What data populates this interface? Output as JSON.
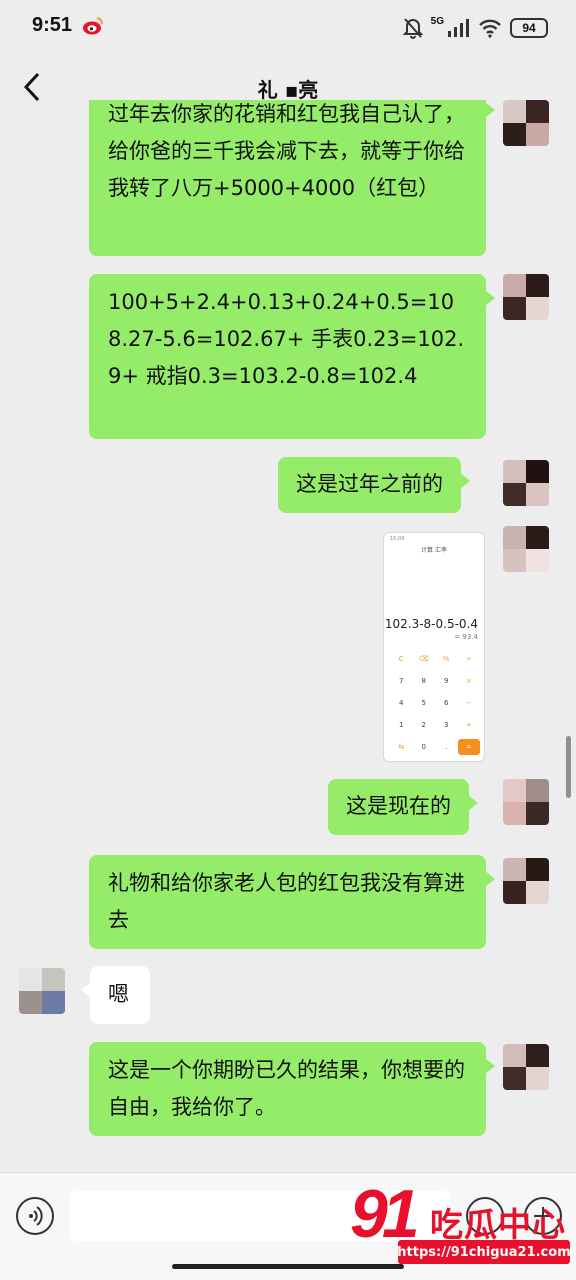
{
  "status_bar": {
    "time": "9:51",
    "network": "5G",
    "battery": "94",
    "icons": [
      "weibo-icon",
      "mute-bell-icon",
      "signal-icon",
      "wifi-icon",
      "battery-icon"
    ]
  },
  "header": {
    "title": "礼 ▪亮",
    "back_icon": "chevron-left-icon"
  },
  "messages": [
    {
      "side": "me",
      "text": "过年去你家的花销和红包我自己认了，给你爸的三千我会减下去，就等于你给我转了八万+5000+4000（红包）"
    },
    {
      "side": "me",
      "text": "100+5+2.4+0.13+0.24+0.5=108.27-5.6=102.67+ 手表0.23=102.9+ 戒指0.3=103.2-0.8=102.4"
    },
    {
      "side": "me",
      "text": "这是过年之前的"
    },
    {
      "side": "me",
      "type": "image",
      "image": {
        "status_time": "10:09",
        "tabs": "计算   汇率",
        "expression": "102.3-8-0.5-0.4",
        "result": "= 93.4",
        "keys": [
          "C",
          "⌫",
          "%",
          "÷",
          "7",
          "8",
          "9",
          "×",
          "4",
          "5",
          "6",
          "−",
          "1",
          "2",
          "3",
          "+",
          "⇆",
          "0",
          ".",
          "="
        ]
      }
    },
    {
      "side": "me",
      "text": "这是现在的"
    },
    {
      "side": "me",
      "text": "礼物和给你家老人包的红包我没有算进去"
    },
    {
      "side": "them",
      "text": "嗯"
    },
    {
      "side": "me",
      "text": "这是一个你期盼已久的结果，你想要的自由，我给你了。"
    }
  ],
  "input_bar": {
    "placeholder": "",
    "icons": [
      "voice-icon",
      "emoji-icon",
      "plus-icon"
    ]
  },
  "watermark": {
    "logo": "91",
    "name": "吃瓜中心",
    "url": "https://91chigua21.com"
  },
  "colors": {
    "background": "#ededed",
    "my_bubble": "#95ec69",
    "their_bubble": "#ffffff",
    "watermark_red": "#e8112d",
    "calculator_orange": "#f58d1f"
  }
}
